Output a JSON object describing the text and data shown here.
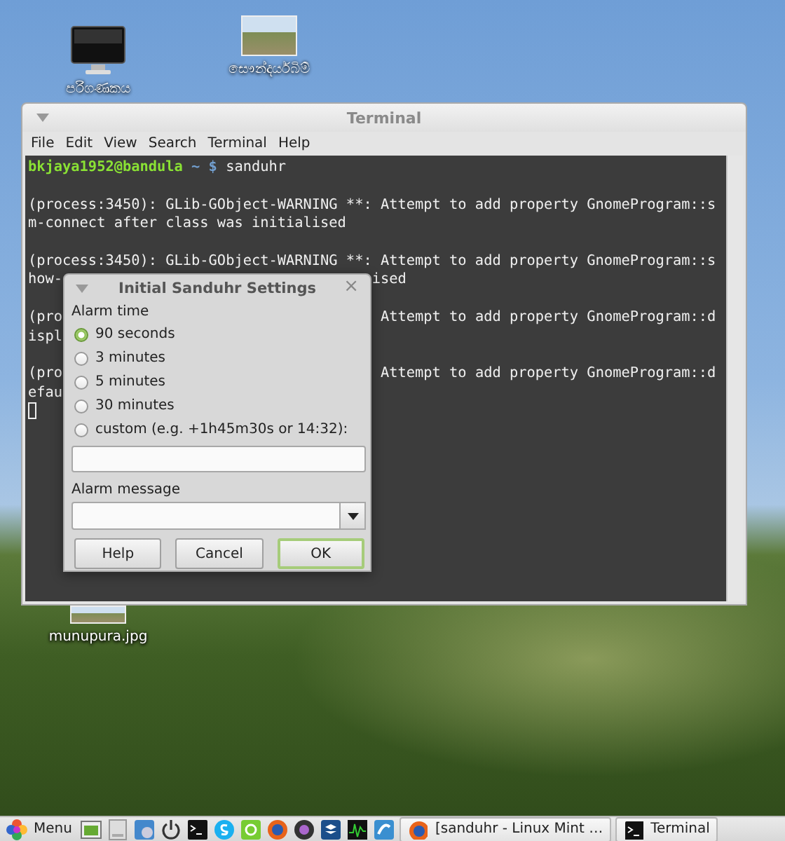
{
  "desktop": {
    "icons": [
      {
        "kind": "computer",
        "label": "පරිගණකය"
      },
      {
        "kind": "photo",
        "label": "සෞන්දර්යබිම්"
      },
      {
        "kind": "photo",
        "label": "munupura.jpg"
      }
    ]
  },
  "terminal": {
    "title": "Terminal",
    "menu": [
      "File",
      "Edit",
      "View",
      "Search",
      "Terminal",
      "Help"
    ],
    "prompt": {
      "user_host": "bkjaya1952@bandula",
      "path": "~",
      "symbol": "$",
      "command": "sanduhr"
    },
    "output": [
      [
        "(process:3450): GLib-GObject-WARNING **: Attempt to add property GnomeProgram::s",
        "m-connect after class was initialised"
      ],
      [
        "(process:3450): GLib-GObject-WARNING **: Attempt to add property GnomeProgram::s",
        "how-                                    ised"
      ],
      [
        "(pro                                     Attempt to add property GnomeProgram::d",
        "ispl"
      ],
      [
        "(pro                                     Attempt to add property GnomeProgram::d",
        "efau"
      ]
    ]
  },
  "dialog": {
    "title": "Initial Sanduhr Settings",
    "close": "×",
    "alarm_time_label": "Alarm time",
    "options": [
      {
        "label": "90 seconds",
        "selected": true
      },
      {
        "label": "3 minutes",
        "selected": false
      },
      {
        "label": "5 minutes",
        "selected": false
      },
      {
        "label": "30 minutes",
        "selected": false
      },
      {
        "label": "custom (e.g. +1h45m30s or 14:32):",
        "selected": false
      }
    ],
    "message_label": "Alarm message",
    "buttons": [
      {
        "label": "Help",
        "focused": false
      },
      {
        "label": "Cancel",
        "focused": false
      },
      {
        "label": "OK",
        "focused": true
      }
    ]
  },
  "taskbar": {
    "menu_label": "Menu",
    "windows": [
      {
        "kind": "browser",
        "label": "[sanduhr - Linux Mint …"
      },
      {
        "kind": "terminal",
        "label": "Terminal"
      }
    ]
  }
}
